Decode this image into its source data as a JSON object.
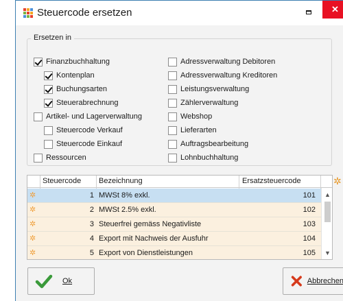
{
  "window": {
    "title": "Steuercode ersetzen",
    "close_glyph": "✕"
  },
  "group": {
    "legend": "Ersetzen in",
    "left_items": [
      {
        "label": "Finanzbuchhaltung",
        "checked": true
      },
      {
        "label": "Kontenplan",
        "checked": true
      },
      {
        "label": "Buchungsarten",
        "checked": true
      },
      {
        "label": "Steuerabrechnung",
        "checked": true
      },
      {
        "label": "Artikel- und Lagerverwaltung",
        "checked": false
      },
      {
        "label": "Steuercode Verkauf",
        "checked": false
      },
      {
        "label": "Steuercode Einkauf",
        "checked": false
      },
      {
        "label": "Ressourcen",
        "checked": false
      }
    ],
    "right_items": [
      {
        "label": "Adressverwaltung Debitoren",
        "checked": false
      },
      {
        "label": "Adressverwaltung Kreditoren",
        "checked": false
      },
      {
        "label": "Leistungsverwaltung",
        "checked": false
      },
      {
        "label": "Zählerverwaltung",
        "checked": false
      },
      {
        "label": "Webshop",
        "checked": false
      },
      {
        "label": "Lieferarten",
        "checked": false
      },
      {
        "label": "Auftragsbearbeitung",
        "checked": false
      },
      {
        "label": "Lohnbuchhaltung",
        "checked": false
      }
    ]
  },
  "grid": {
    "headers": {
      "code": "Steuercode",
      "bezeichnung": "Bezeichnung",
      "ersatz": "Ersatzsteuercode"
    },
    "rows": [
      {
        "code": "1",
        "bezeichnung": "MWSt 8% exkl.",
        "ersatz": "101"
      },
      {
        "code": "2",
        "bezeichnung": "MWSt 2.5% exkl.",
        "ersatz": "102"
      },
      {
        "code": "3",
        "bezeichnung": "Steuerfrei gemäss Negativliste",
        "ersatz": "103"
      },
      {
        "code": "4",
        "bezeichnung": "Export mit Nachweis der Ausfuhr",
        "ersatz": "104"
      },
      {
        "code": "5",
        "bezeichnung": "Export von Dienstleistungen",
        "ersatz": "105"
      }
    ]
  },
  "buttons": {
    "ok_label": "Ok",
    "cancel_label": "Abbrechen"
  },
  "colors": {
    "row_selected": "#c7dff2",
    "row_normal": "#fbf0df",
    "close_red": "#e81123",
    "ok_green": "#3a9a3a",
    "cancel_red": "#d63a1c"
  }
}
